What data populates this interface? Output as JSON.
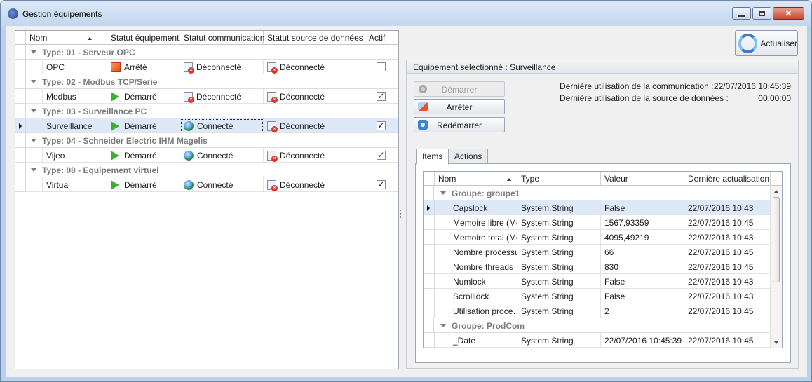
{
  "window": {
    "title": "Gestion équipements"
  },
  "equipment_grid": {
    "columns": [
      "Nom",
      "Statut équipement",
      "Statut communication",
      "Statut source de données",
      "Actif"
    ],
    "groups": [
      {
        "label": "Type: 01 - Serveur OPC",
        "rows": [
          {
            "name": "OPC",
            "equipment_status": "Arrêté",
            "equipment_icon": "stop-icon",
            "comm_status": "Déconnecté",
            "comm_icon": "disconnected-icon",
            "source_status": "Déconnecté",
            "source_icon": "source-disconnected-icon",
            "active": false
          }
        ]
      },
      {
        "label": "Type: 02 - Modbus TCP/Serie",
        "rows": [
          {
            "name": "Modbus",
            "equipment_status": "Démarré",
            "equipment_icon": "play-icon",
            "comm_status": "Déconnecté",
            "comm_icon": "disconnected-icon",
            "source_status": "Déconnecté",
            "source_icon": "source-disconnected-icon",
            "active": true
          }
        ]
      },
      {
        "label": "Type: 03 - Surveillance PC",
        "rows": [
          {
            "name": "Surveillance",
            "equipment_status": "Démarré",
            "equipment_icon": "play-icon",
            "comm_status": "Connecté",
            "comm_icon": "connected-icon",
            "source_status": "Déconnecté",
            "source_icon": "source-disconnected-icon",
            "active": true,
            "selected": true
          }
        ]
      },
      {
        "label": "Type: 04 - Schneider Electric IHM Magelis",
        "rows": [
          {
            "name": "Vijeo",
            "equipment_status": "Démarré",
            "equipment_icon": "play-icon",
            "comm_status": "Connecté",
            "comm_icon": "connected-icon",
            "source_status": "Déconnecté",
            "source_icon": "source-disconnected-icon",
            "active": true
          }
        ]
      },
      {
        "label": "Type: 08 - Equipement virtuel",
        "rows": [
          {
            "name": "Virtual",
            "equipment_status": "Démarré",
            "equipment_icon": "play-icon",
            "comm_status": "Connecté",
            "comm_icon": "connected-icon",
            "source_status": "Déconnecté",
            "source_icon": "source-disconnected-icon",
            "active": true
          }
        ]
      }
    ]
  },
  "toolbar": {
    "refresh_label": "Actualiser"
  },
  "selected_panel": {
    "title": "Equipement selectionné : Surveillance",
    "buttons": {
      "start": "Démarrer",
      "stop": "Arrêter",
      "restart": "Redémarrer"
    },
    "last_comm_label": "Dernière utilisation de la communication :",
    "last_comm_value": "22/07/2016 10:45:39",
    "last_source_label": "Dernière utilisation de la source de données :",
    "last_source_value": "00:00:00",
    "tabs": [
      "Items",
      "Actions"
    ],
    "active_tab": "Items"
  },
  "items_grid": {
    "columns": [
      "Nom",
      "Type",
      "Valeur",
      "Dernière actualisation"
    ],
    "groups": [
      {
        "label": "Groupe: groupe1",
        "rows": [
          {
            "name": "Capslock",
            "type": "System.String",
            "value": "False",
            "updated": "22/07/2016 10:43",
            "selected": true
          },
          {
            "name": "Memoire libre (Mo)",
            "type": "System.String",
            "value": "1567,93359",
            "updated": "22/07/2016 10:45"
          },
          {
            "name": "Memoire total (Mo)",
            "type": "System.String",
            "value": "4095,49219",
            "updated": "22/07/2016 10:43"
          },
          {
            "name": "Nombre processus",
            "type": "System.String",
            "value": "66",
            "updated": "22/07/2016 10:45"
          },
          {
            "name": "Nombre threads",
            "type": "System.String",
            "value": "830",
            "updated": "22/07/2016 10:45"
          },
          {
            "name": "Numlock",
            "type": "System.String",
            "value": "False",
            "updated": "22/07/2016 10:43"
          },
          {
            "name": "Scrolllock",
            "type": "System.String",
            "value": "False",
            "updated": "22/07/2016 10:43"
          },
          {
            "name": "Utilisation proce…",
            "type": "System.String",
            "value": "2",
            "updated": "22/07/2016 10:45"
          }
        ]
      },
      {
        "label": "Groupe: ProdCom",
        "rows": [
          {
            "name": "_Date",
            "type": "System.String",
            "value": "22/07/2016 10:45:39",
            "updated": "22/07/2016 10:45"
          }
        ]
      }
    ]
  },
  "colors": {
    "window_frame": "#b9d1ea",
    "selection": "#dde8f8",
    "group_text": "#7b7b7b",
    "started": "#3cb032",
    "stopped": "#e2481c"
  }
}
